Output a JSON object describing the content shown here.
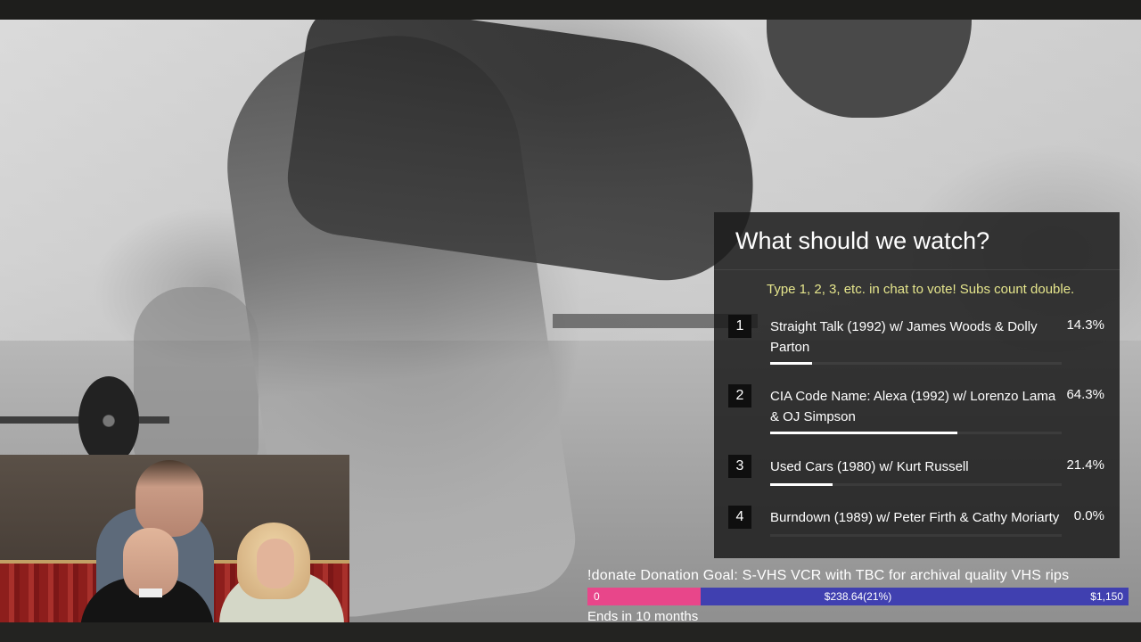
{
  "poll": {
    "title": "What should we watch?",
    "instructions": "Type 1, 2, 3, etc. in chat to vote! Subs count double.",
    "options": [
      {
        "number": "1",
        "label": "Straight Talk (1992) w/ James Woods & Dolly Parton",
        "percent_text": "14.3%",
        "share": 0.143
      },
      {
        "number": "2",
        "label": "CIA Code Name: Alexa (1992) w/ Lorenzo Lama & OJ Simpson",
        "percent_text": "64.3%",
        "share": 0.643
      },
      {
        "number": "3",
        "label": "Used Cars (1980) w/ Kurt Russell",
        "percent_text": "21.4%",
        "share": 0.214
      },
      {
        "number": "4",
        "label": "Burndown (1989) w/ Peter Firth & Cathy Moriarty",
        "percent_text": "0.0%",
        "share": 0.0
      }
    ]
  },
  "donation": {
    "title": "!donate Donation Goal: S-VHS VCR with TBC for archival quality VHS rips",
    "start_label": "0",
    "current_label": "$238.64(21%)",
    "goal_label": "$1,150",
    "progress": 0.21,
    "ends": "Ends in 10 months",
    "colors": {
      "fill": "#e8468a",
      "track": "#4040b0"
    }
  },
  "colors": {
    "instructions": "#e5e58c",
    "panel": "#1c1c1c"
  }
}
